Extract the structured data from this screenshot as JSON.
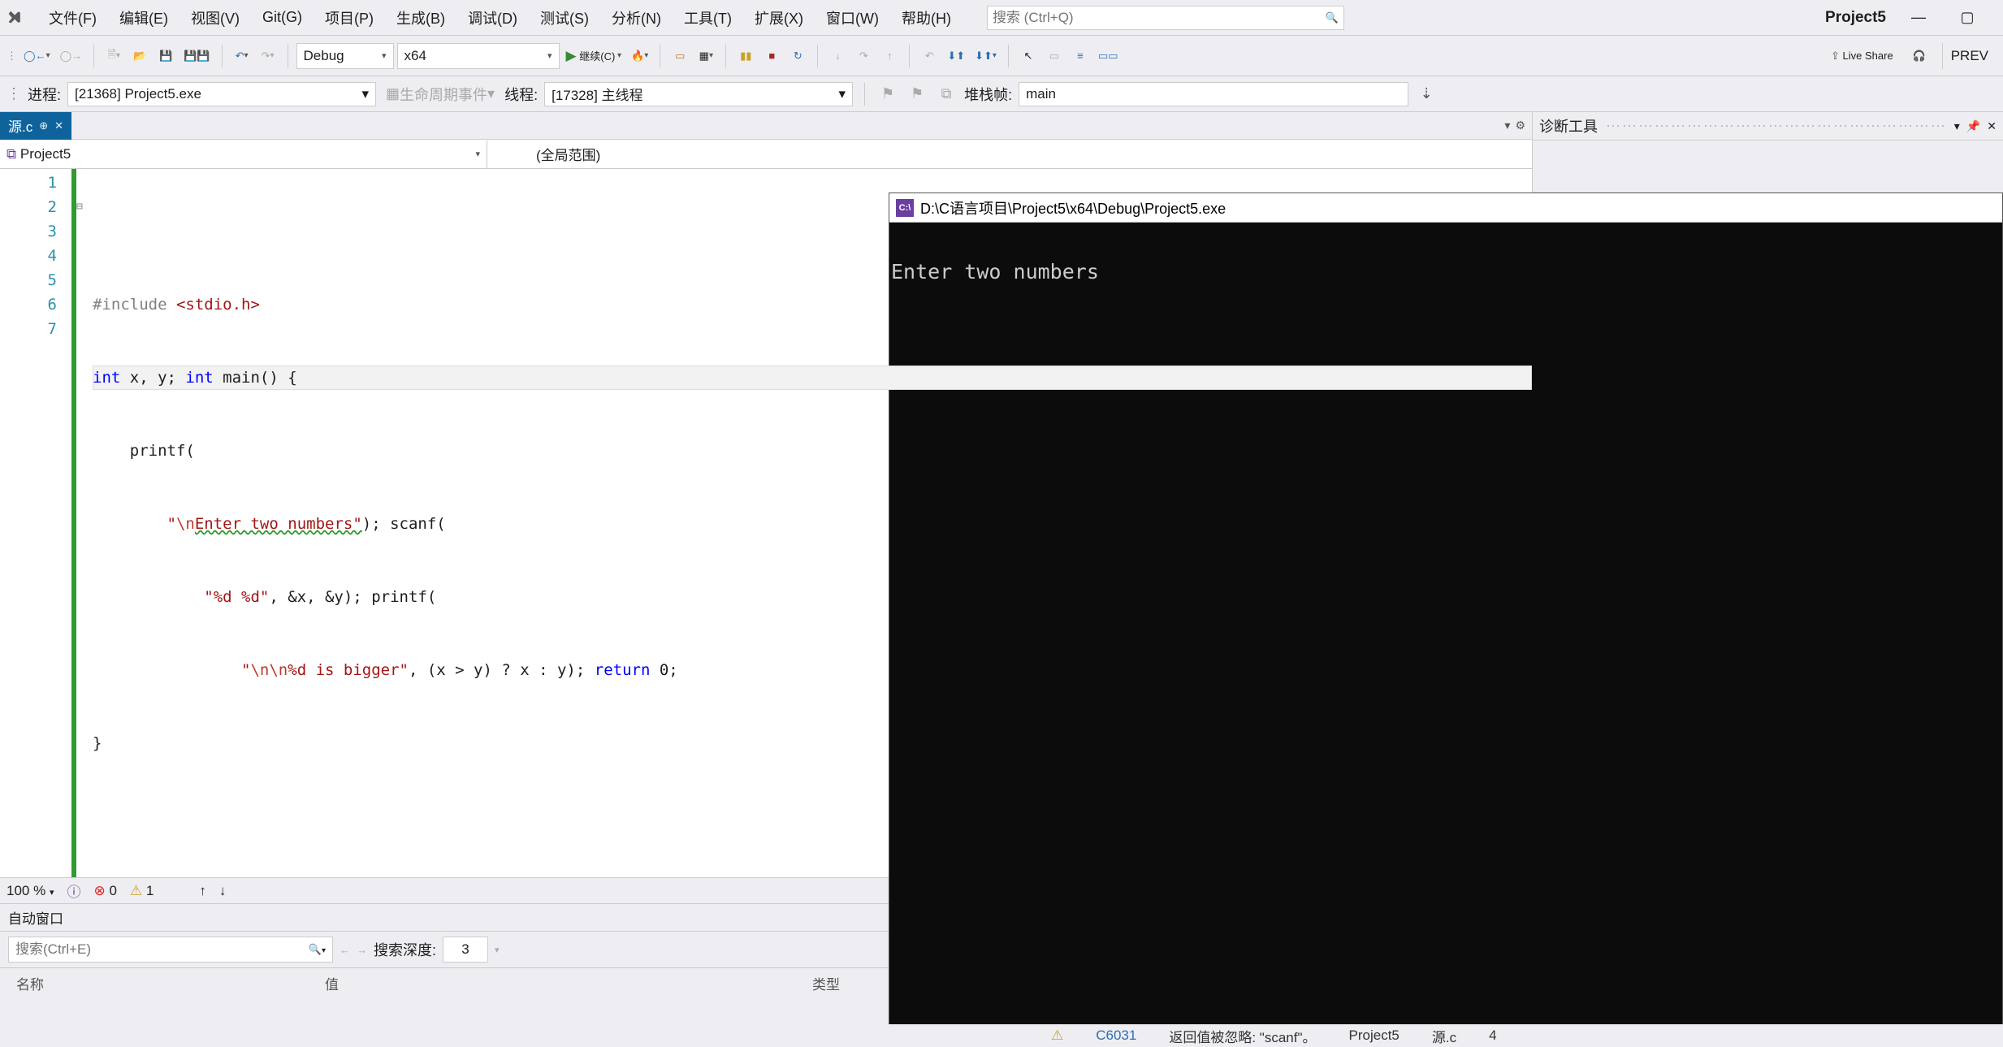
{
  "menubar": {
    "items": [
      "文件(F)",
      "编辑(E)",
      "视图(V)",
      "Git(G)",
      "项目(P)",
      "生成(B)",
      "调试(D)",
      "测试(S)",
      "分析(N)",
      "工具(T)",
      "扩展(X)",
      "窗口(W)",
      "帮助(H)"
    ],
    "search_placeholder": "搜索 (Ctrl+Q)",
    "project_title": "Project5"
  },
  "toolbar": {
    "config": "Debug",
    "platform": "x64",
    "continue_label": "继续(C)",
    "liveshare": "Live Share",
    "preview": "PREV"
  },
  "debugbar": {
    "process_label": "进程:",
    "process_value": "[21368] Project5.exe",
    "lifecycle": "生命周期事件",
    "thread_label": "线程:",
    "thread_value": "[17328] 主线程",
    "stack_label": "堆栈帧:",
    "stack_value": "main"
  },
  "editor": {
    "tab_name": "源.c",
    "project_combo": "Project5",
    "scope_combo": "(全局范围)",
    "line_numbers": [
      "1",
      "2",
      "3",
      "4",
      "5",
      "6",
      "7"
    ],
    "code": {
      "l1_pp": "#include ",
      "l1_inc": "<stdio.h>",
      "l2_a": "int",
      "l2_b": " x, y; ",
      "l2_c": "int",
      "l2_d": " main() {",
      "l3": "    printf(",
      "l4_a": "        ",
      "l4_q1": "\"",
      "l4_esc": "\\n",
      "l4_str": "Enter two numbers\"",
      "l4_b": "); scanf(",
      "l5_a": "            ",
      "l5_str": "\"%d %d\"",
      "l5_b": ", &x, &y); printf(",
      "l6_a": "                ",
      "l6_q1": "\"",
      "l6_esc": "\\n\\n",
      "l6_str": "%d is bigger\"",
      "l6_b": ", (x > y) ? x : y); ",
      "l6_ret": "return",
      "l6_c": " 0;",
      "l7": "}"
    }
  },
  "status": {
    "zoom": "100 %",
    "errors": "0",
    "warnings": "1"
  },
  "autos": {
    "title": "自动窗口",
    "search_placeholder": "搜索(Ctrl+E)",
    "depth_label": "搜索深度:",
    "depth_value": "3",
    "col_name": "名称",
    "col_value": "值",
    "col_type": "类型"
  },
  "diag": {
    "title": "诊断工具"
  },
  "console": {
    "title": "D:\\C语言项目\\Project5\\x64\\Debug\\Project5.exe",
    "output": "Enter two numbers"
  },
  "bottom": {
    "code": "C6031",
    "msg": "返回值被忽略: \"scanf\"。",
    "proj": "Project5",
    "file": "源.c",
    "line": "4"
  }
}
